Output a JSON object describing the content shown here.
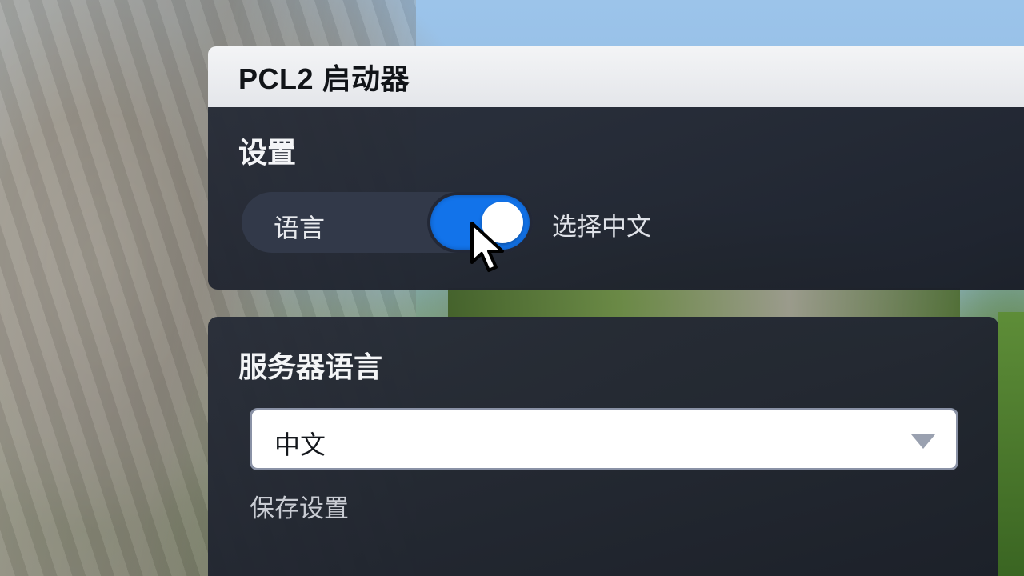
{
  "window": {
    "title": "PCL2 启动器"
  },
  "settings": {
    "heading": "设置",
    "language_label": "语言",
    "toggle_state": "on",
    "toggle_caption": "选择中文"
  },
  "server": {
    "heading": "服务器语言",
    "selected_language": "中文",
    "save_label": "保存设置"
  },
  "colors": {
    "accent": "#1273ea",
    "panel": "#262b36",
    "titlebar": "#eceef1"
  },
  "icons": {
    "cursor": "mouse-pointer-icon",
    "dropdown": "chevron-down-icon"
  }
}
